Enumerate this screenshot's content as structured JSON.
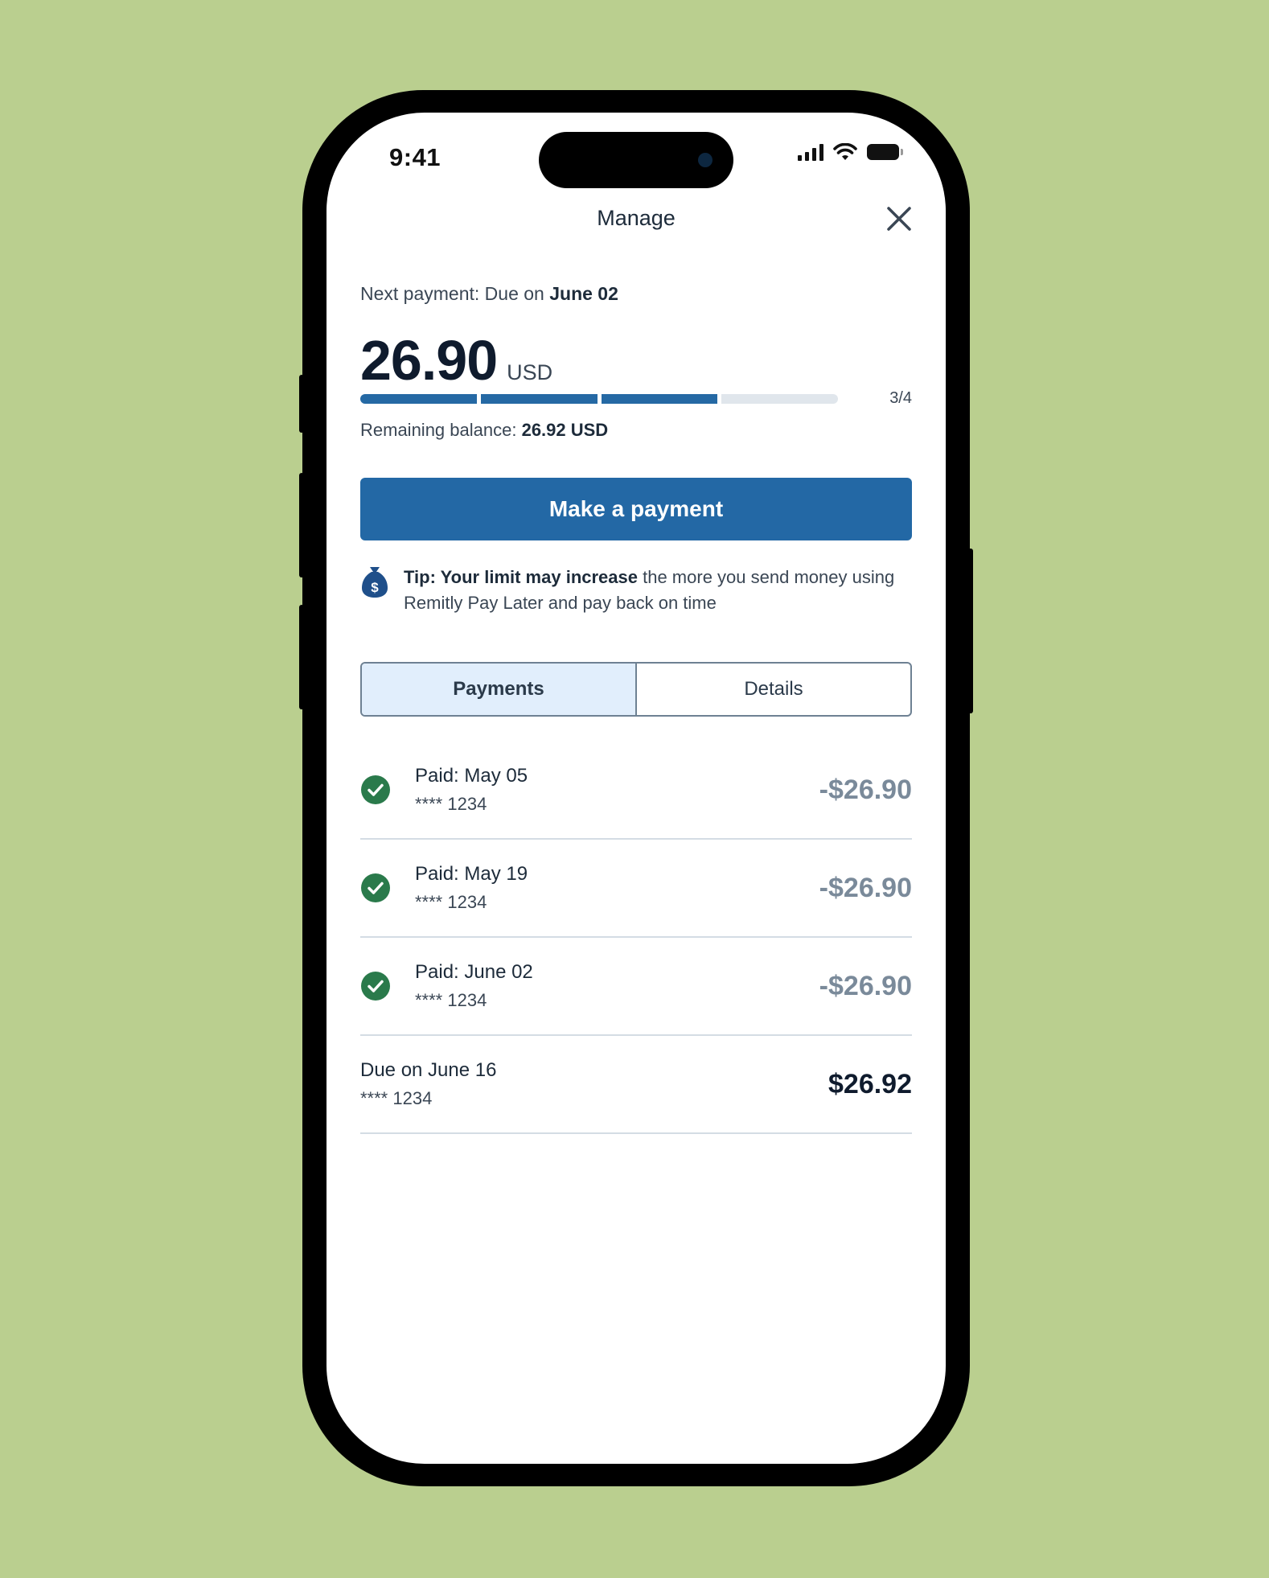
{
  "status_bar": {
    "time": "9:41"
  },
  "header": {
    "title": "Manage"
  },
  "next_payment": {
    "label": "Next payment: Due on ",
    "date": "June 02"
  },
  "amount": {
    "value": "26.90",
    "currency": "USD"
  },
  "progress": {
    "completed": 3,
    "total": 4,
    "label": "3/4"
  },
  "remaining": {
    "label": "Remaining balance: ",
    "value": "26.92 USD"
  },
  "pay_button": {
    "label": "Make a payment"
  },
  "tip": {
    "bold": "Tip: Your limit may increase",
    "text": " the more you send money using Remitly Pay Later and pay back on time"
  },
  "tabs": [
    {
      "label": "Payments",
      "active": true
    },
    {
      "label": "Details",
      "active": false
    }
  ],
  "payments": [
    {
      "title": "Paid: May 05",
      "card": "**** 1234",
      "amount": "-$26.90",
      "status": "paid"
    },
    {
      "title": "Paid: May 19",
      "card": "**** 1234",
      "amount": "-$26.90",
      "status": "paid"
    },
    {
      "title": "Paid: June 02",
      "card": "**** 1234",
      "amount": "-$26.90",
      "status": "paid"
    },
    {
      "title": "Due on June 16",
      "card": "**** 1234",
      "amount": "$26.92",
      "status": "due"
    }
  ],
  "colors": {
    "background": "#bacf8f",
    "accent": "#2368a5",
    "success": "#2a7a4b",
    "muted_amount": "#7a8a9a"
  },
  "icons": {
    "close": "close-icon",
    "tip": "money-bag-icon",
    "paid": "check-circle-icon"
  }
}
